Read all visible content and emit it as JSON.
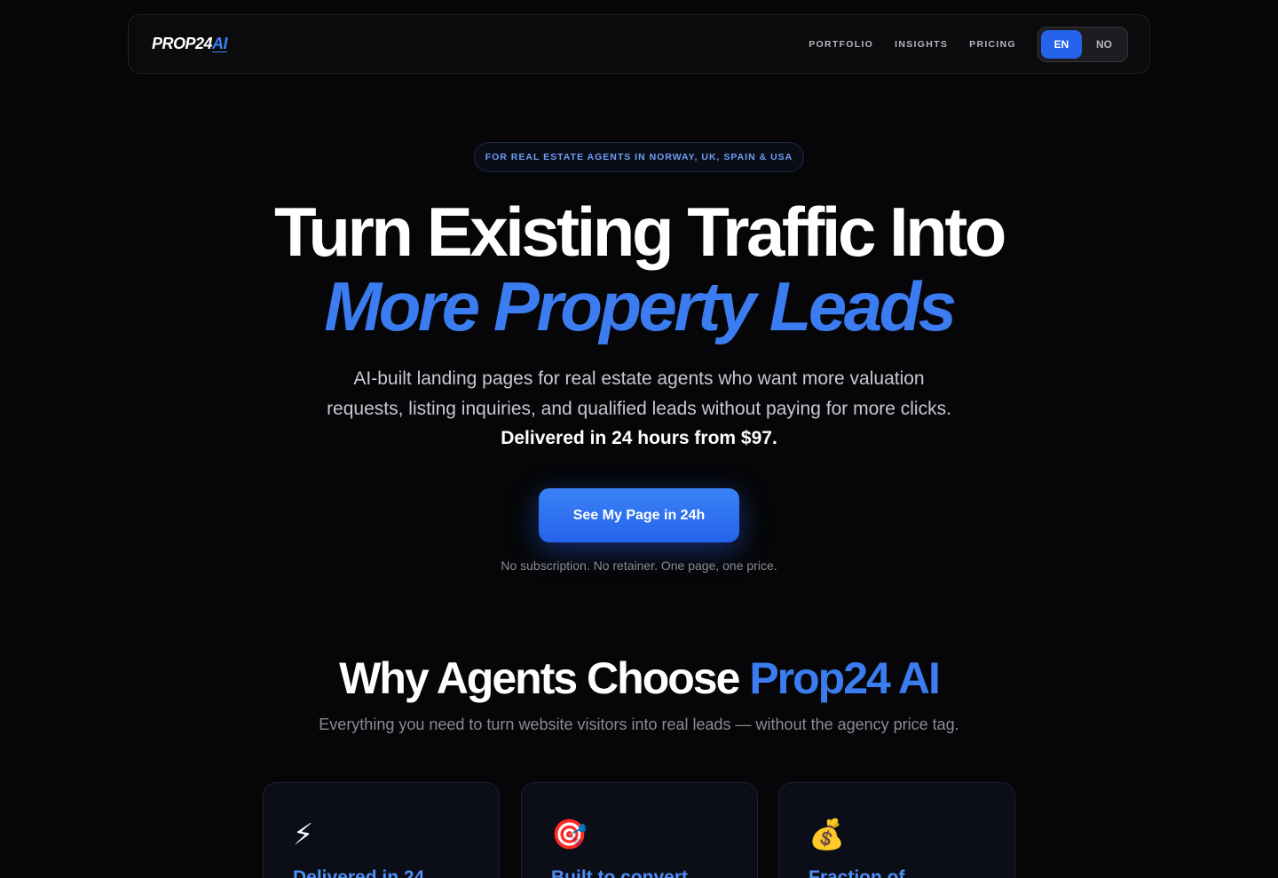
{
  "nav": {
    "logo_main": "PROP24",
    "logo_accent": "AI",
    "links": [
      "PORTFOLIO",
      "INSIGHTS",
      "PRICING"
    ],
    "languages": [
      "EN",
      "NO"
    ],
    "active_language": "EN"
  },
  "hero": {
    "pill": "FOR REAL ESTATE AGENTS IN NORWAY, UK, SPAIN & USA",
    "title_line1": "Turn Existing Traffic Into",
    "title_line2": "More Property Leads",
    "subtitle": "AI-built landing pages for real estate agents who want more valuation requests, listing inquiries, and qualified leads without paying for more clicks.",
    "subtitle_strong": "Delivered in 24 hours from $97.",
    "cta_label": "See My Page in 24h",
    "note": "No subscription. No retainer. One page, one price."
  },
  "why": {
    "title_main": "Why Agents Choose",
    "title_accent": "Prop24 AI",
    "subtitle": "Everything you need to turn website visitors into real leads — without the agency price tag.",
    "cards": [
      {
        "icon": "⚡",
        "icon_name": "lightning-icon",
        "title": "Delivered in 24"
      },
      {
        "icon": "🎯",
        "icon_name": "target-icon",
        "title": "Built to convert"
      },
      {
        "icon": "💰",
        "icon_name": "money-bag-icon",
        "title": "Fraction of"
      }
    ]
  },
  "colors": {
    "accent": "#3b82f6",
    "background": "#060608"
  }
}
